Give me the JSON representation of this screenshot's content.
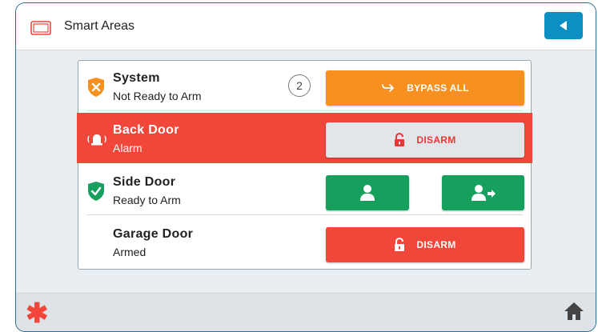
{
  "header": {
    "title": "Smart Areas",
    "app_icon": "tablet-icon",
    "back_icon": "back-arrow-icon"
  },
  "areas": [
    {
      "name": "System",
      "state": "Not Ready to Arm",
      "status_icon": "shield-x-icon",
      "count": "2",
      "action": {
        "label": "BYPASS ALL",
        "icon": "bypass-arrow-icon",
        "color": "#f7901e"
      }
    },
    {
      "name": "Back Door",
      "state": "Alarm",
      "status_icon": "alarm-siren-icon",
      "row_color": "#f0473a",
      "action": {
        "label": "DISARM",
        "icon": "unlock-icon",
        "color": "#e3e6e8"
      }
    },
    {
      "name": "Side Door",
      "state": "Ready to Arm",
      "status_icon": "shield-check-icon",
      "actions": [
        {
          "icon": "person-icon",
          "color": "#17a05d"
        },
        {
          "icon": "person-arrow-icon",
          "color": "#17a05d"
        }
      ]
    },
    {
      "name": "Garage Door",
      "state": "Armed",
      "action": {
        "label": "DISARM",
        "icon": "unlock-icon",
        "color": "#f0473a"
      }
    }
  ],
  "footer": {
    "left_icon": "asterisk-icon",
    "right_icon": "home-icon"
  },
  "colors": {
    "accent_blue": "#0d8fc4",
    "alarm_red": "#f0473a",
    "warning_orange": "#f7901e",
    "ready_green": "#17a05d"
  }
}
